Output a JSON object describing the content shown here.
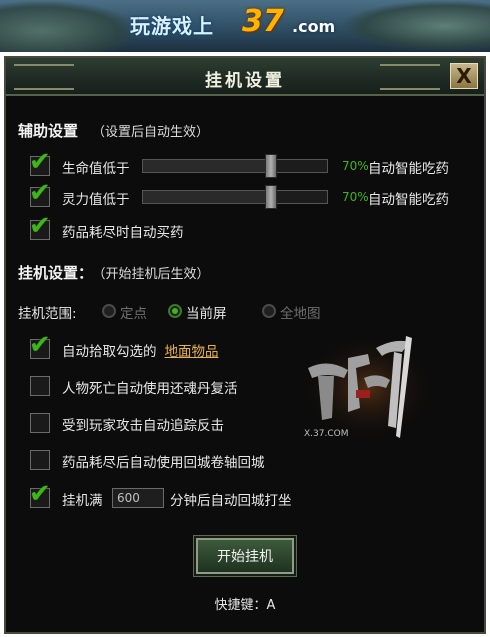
{
  "banner": {
    "text": "玩游戏上",
    "brand": "37",
    "domain": ".com"
  },
  "dialog": {
    "title": "挂机设置",
    "close_label": "X"
  },
  "assist": {
    "heading": "辅助设置",
    "note": "（设置后自动生效）",
    "hp": {
      "label": "生命值低于",
      "percent": "70%",
      "percent_value": 0.7,
      "action": "自动智能吃药",
      "checked": true
    },
    "mp": {
      "label": "灵力值低于",
      "percent": "70%",
      "percent_value": 0.7,
      "action": "自动智能吃药",
      "checked": true
    },
    "buy": {
      "label": "药品耗尽时自动买药",
      "checked": true
    }
  },
  "afk": {
    "heading": "挂机设置：",
    "note": "（开始挂机后生效）",
    "range_label": "挂机范围:",
    "range_options": [
      "定点",
      "当前屏",
      "全地图"
    ],
    "range_selected": "当前屏",
    "pickup": {
      "label": "自动拾取勾选的",
      "link": "地面物品",
      "checked": true
    },
    "revive": {
      "label": "人物死亡自动使用还魂丹复活",
      "checked": false
    },
    "counter": {
      "label": "受到玩家攻击自动追踪反击",
      "checked": false
    },
    "return_scroll": {
      "label": "药品耗尽后自动使用回城卷轴回城",
      "checked": false
    },
    "full": {
      "label_before": "挂机满",
      "value": "600",
      "label_after": "分钟后自动回城打坐",
      "checked": true
    }
  },
  "start_button": "开始挂机",
  "hotkey": "快捷键：A",
  "emblem": {
    "name": "轩辕剑",
    "site": "X.37.COM"
  },
  "colors": {
    "accent_green": "#3fb51a",
    "link_gold": "#e8b24a",
    "brand_orange": "#ffb400"
  }
}
